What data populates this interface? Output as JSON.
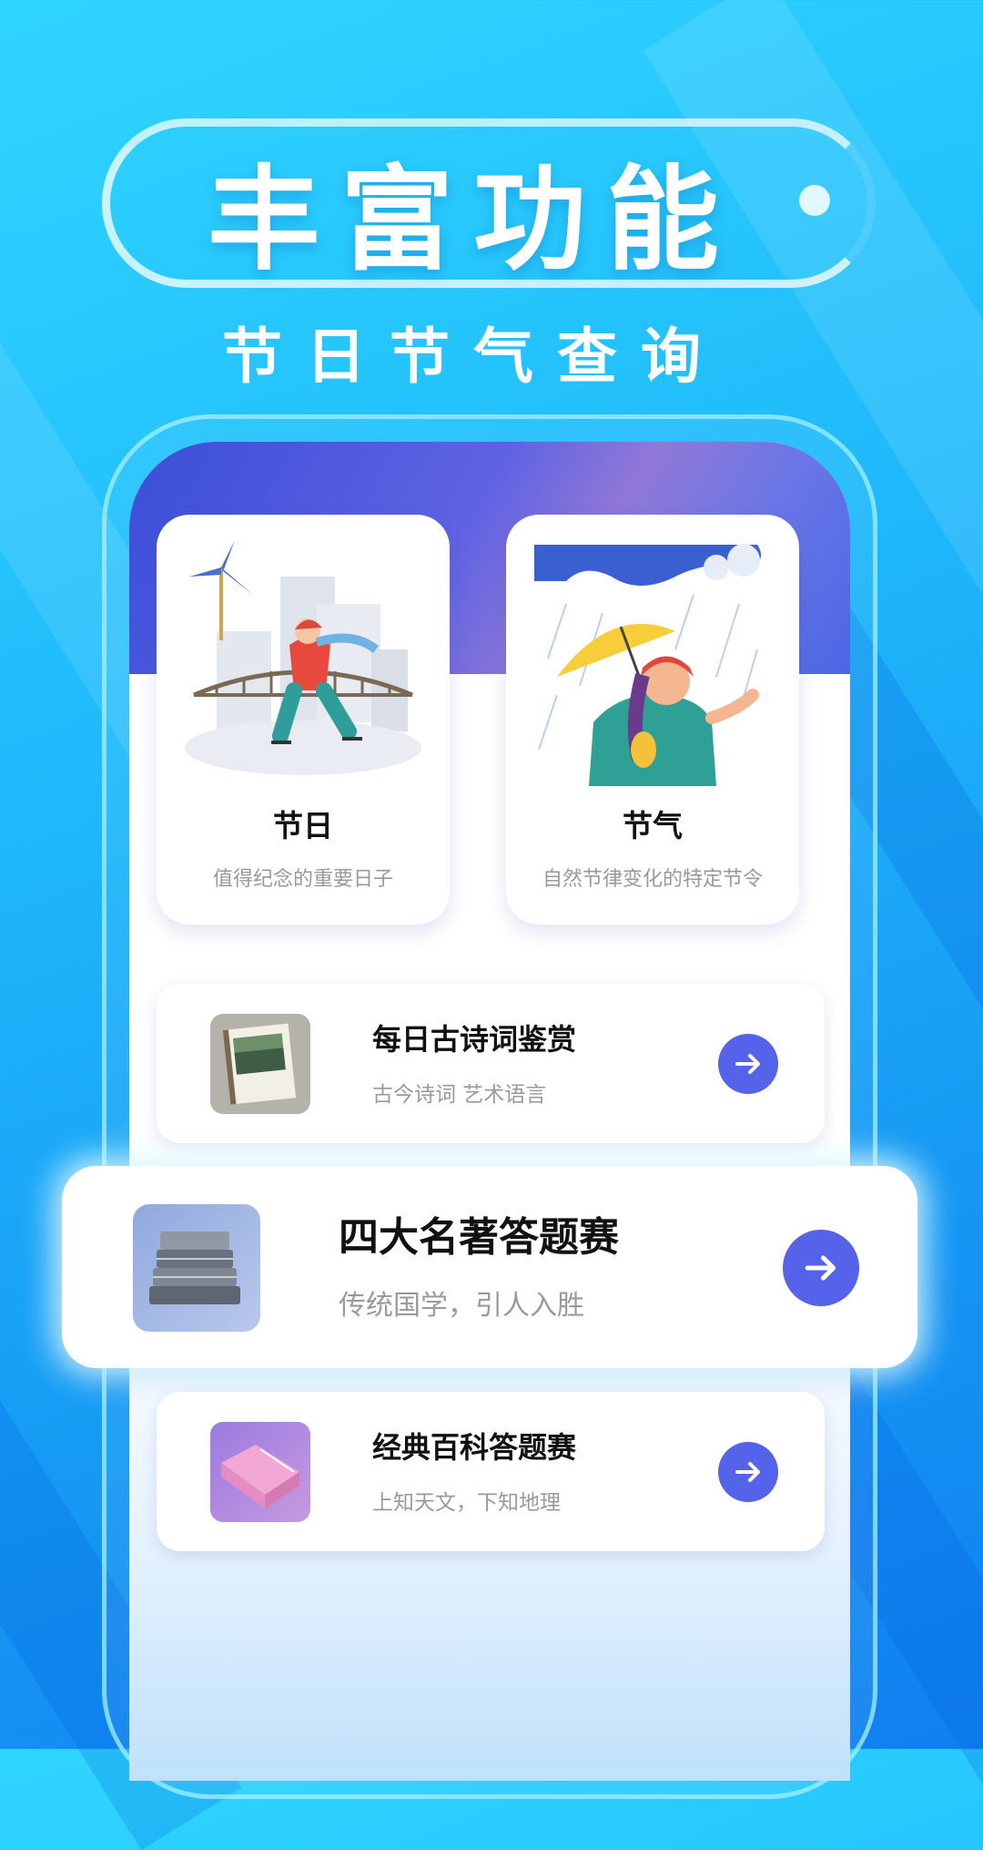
{
  "header": {
    "title": "丰富功能",
    "subtitle": "节日节气查询"
  },
  "features": [
    {
      "title": "节日",
      "desc": "值得纪念的重要日子",
      "icon": "skating-illustration"
    },
    {
      "title": "节气",
      "desc": "自然节律变化的特定节令",
      "icon": "rain-umbrella-illustration"
    }
  ],
  "list": [
    {
      "title": "每日古诗词鉴赏",
      "subtitle": "古今诗词 艺术语言",
      "icon": "poetry-book-icon"
    },
    {
      "title": "四大名著答题赛",
      "subtitle": "传统国学，引人入胜",
      "icon": "stacked-books-icon"
    },
    {
      "title": "经典百科答题赛",
      "subtitle": "上知天文，下知地理",
      "icon": "open-book-icon"
    }
  ],
  "colors": {
    "accent": "#5562ea",
    "background_top": "#2fd6ff",
    "background_bottom": "#0f7ff0",
    "banner": "#3b4ed8"
  }
}
